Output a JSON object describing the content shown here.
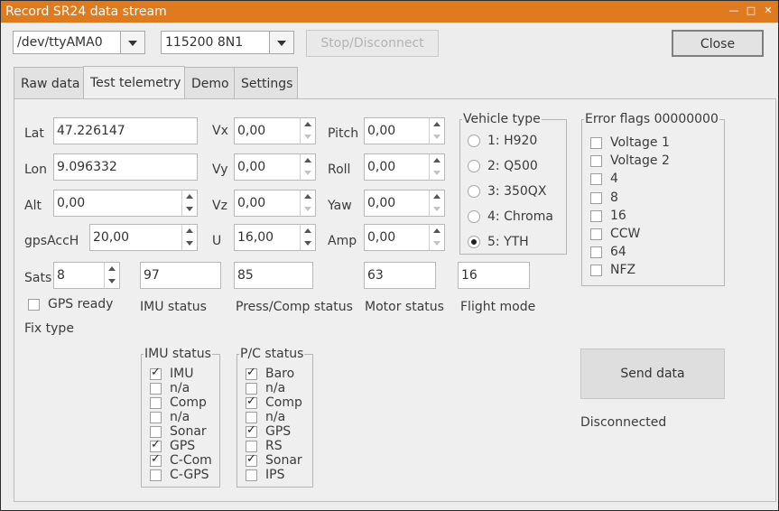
{
  "window": {
    "title": "Record SR24 data stream"
  },
  "toolbar": {
    "port": "/dev/ttyAMA0",
    "baud": "115200 8N1",
    "stop_label": "Stop/Disconnect",
    "close_label": "Close"
  },
  "tabs": [
    "Raw data",
    "Test telemetry",
    "Demo",
    "Settings"
  ],
  "telemetry": {
    "lat_label": "Lat",
    "lat": "47.226147",
    "lon_label": "Lon",
    "lon": "9.096332",
    "alt_label": "Alt",
    "alt": "0,00",
    "gpsacch_label": "gpsAccH",
    "gpsacch": "20,00",
    "sats_label": "Sats",
    "sats": "8",
    "gps_ready_label": "GPS ready",
    "fix_type_label": "Fix type",
    "vx_label": "Vx",
    "vx": "0,00",
    "vy_label": "Vy",
    "vy": "0,00",
    "vz_label": "Vz",
    "vz": "0,00",
    "u_label": "U",
    "u": "16,00",
    "pitch_label": "Pitch",
    "pitch": "0,00",
    "roll_label": "Roll",
    "roll": "0,00",
    "yaw_label": "Yaw",
    "yaw": "0,00",
    "amp_label": "Amp",
    "amp": "0,00",
    "imu_status_value": "97",
    "imu_status_label": "IMU status",
    "press_comp_value": "85",
    "press_comp_label": "Press/Comp status",
    "motor_status_value": "63",
    "motor_status_label": "Motor status",
    "flight_mode_value": "16",
    "flight_mode_label": "Flight mode"
  },
  "vehicle_type": {
    "title": "Vehicle type",
    "options": [
      "1: H920",
      "2: Q500",
      "3: 350QX",
      "4: Chroma",
      "5: YTH"
    ],
    "selected_index": 4
  },
  "error_flags": {
    "title": "Error flags 00000000",
    "items": [
      {
        "label": "Voltage 1",
        "checked": false
      },
      {
        "label": "Voltage 2",
        "checked": false
      },
      {
        "label": "4",
        "checked": false
      },
      {
        "label": "8",
        "checked": false
      },
      {
        "label": "16",
        "checked": false
      },
      {
        "label": "CCW",
        "checked": false
      },
      {
        "label": "64",
        "checked": false
      },
      {
        "label": "NFZ",
        "checked": false
      }
    ]
  },
  "imu_status_group": {
    "title": "IMU status",
    "items": [
      {
        "label": "IMU",
        "checked": true
      },
      {
        "label": "n/a",
        "checked": false
      },
      {
        "label": "Comp",
        "checked": false
      },
      {
        "label": "n/a",
        "checked": false
      },
      {
        "label": "Sonar",
        "checked": false
      },
      {
        "label": "GPS",
        "checked": true
      },
      {
        "label": "C-Comp",
        "checked": true
      },
      {
        "label": "C-GPS",
        "checked": false
      }
    ]
  },
  "pc_status_group": {
    "title": "P/C status",
    "items": [
      {
        "label": "Baro",
        "checked": true
      },
      {
        "label": "n/a",
        "checked": false
      },
      {
        "label": "Comp",
        "checked": true
      },
      {
        "label": "n/a",
        "checked": false
      },
      {
        "label": "GPS",
        "checked": true
      },
      {
        "label": "RS",
        "checked": false
      },
      {
        "label": "Sonar",
        "checked": true
      },
      {
        "label": "IPS",
        "checked": false
      }
    ]
  },
  "send_button_label": "Send data",
  "connection_status": "Disconnected"
}
